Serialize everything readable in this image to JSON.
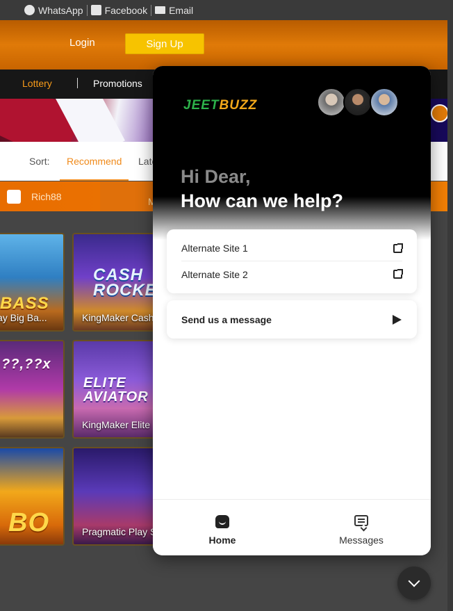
{
  "topbar": {
    "whatsapp": "WhatsApp",
    "facebook": "Facebook",
    "email": "Email"
  },
  "header": {
    "login": "Login",
    "signup": "Sign Up",
    "accent_color": "#f7c300"
  },
  "nav": {
    "lottery": "Lottery",
    "promotions": "Promotions"
  },
  "sort": {
    "label": "Sort:",
    "recommend": "Recommend",
    "latest_partial": "Late"
  },
  "filter": {
    "provider": "Rich88",
    "more": "More"
  },
  "games": [
    {
      "caption": "ay Big Ba...",
      "logo": "BASS"
    },
    {
      "caption": "KingMaker Cash",
      "logo": "CASH ROCKET"
    },
    {
      "caption": "",
      "logo": "??,??x"
    },
    {
      "caption": "KingMaker Elite",
      "logo": "ELITE AVIATOR"
    },
    {
      "caption": "",
      "logo": "BO"
    },
    {
      "caption": "Pragmatic Play S",
      "logo": ""
    }
  ],
  "widget": {
    "logo_j": "JEET",
    "logo_b": "BUZZ",
    "greeting_line1": "Hi Dear,",
    "greeting_line2": "How can we help?",
    "links": [
      {
        "label": "Alternate Site 1",
        "icon": "external-link-icon"
      },
      {
        "label": "Alternate Site 2",
        "icon": "external-link-icon"
      }
    ],
    "send_message": "Send us a message",
    "tabs": {
      "home": "Home",
      "messages": "Messages"
    },
    "brand_green": "#2db24a",
    "brand_orange": "#f2a81a"
  }
}
